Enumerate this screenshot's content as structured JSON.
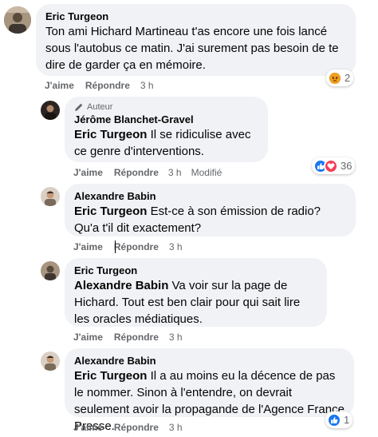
{
  "comments": [
    {
      "author": "Eric Turgeon",
      "mention": "",
      "text": "Ton ami Hichard Martineau t'as encore une fois lancé sous l'autobus ce matin. J'ai surement pas besoin de te dire de garder ça en mémoire.",
      "like_label": "J'aime",
      "reply_label": "Répondre",
      "time": "3 h",
      "reaction_icon": "angry-emoji-icon",
      "reaction_count": "2"
    },
    {
      "badge": "Auteur",
      "author": "Jérôme Blanchet-Gravel",
      "mention": "Eric Turgeon",
      "text": " Il se ridiculise avec ce genre d'interventions.",
      "like_label": "J'aime",
      "reply_label": "Répondre",
      "time": "3 h",
      "modified": "Modifié",
      "reaction_icons": [
        "like-icon",
        "love-icon"
      ],
      "reaction_count": "36"
    },
    {
      "author": "Alexandre Babin",
      "mention": "Eric Turgeon",
      "text": " Est-ce à son émission de radio? Qu'a t'il dit exactement?",
      "like_label": "J'aime",
      "reply_label": "Répondre",
      "time": "3 h"
    },
    {
      "author": "Eric Turgeon",
      "mention": "Alexandre Babin",
      "text": " Va voir sur la page de Hichard. Tout est ben clair pour qui sait lire les oracles médiatiques.",
      "like_label": "J'aime",
      "reply_label": "Répondre",
      "time": "3 h"
    },
    {
      "author": "Alexandre Babin",
      "mention": "Eric Turgeon",
      "text": " Il a au moins eu la décence de pas le nommer. Sinon à l'entendre, on devrait seulement avoir la propagande de l'Agence France Presse.",
      "like_label": "J'aime",
      "reply_label": "Répondre",
      "time": "3 h",
      "reaction_icon": "like-icon",
      "reaction_count": "1"
    }
  ],
  "colors": {
    "bubble": "#f0f2f5",
    "meta_text": "#65676b",
    "like_blue": "#1877f2",
    "love_red": "#f33e58",
    "angry_orange": "#e9710f"
  }
}
